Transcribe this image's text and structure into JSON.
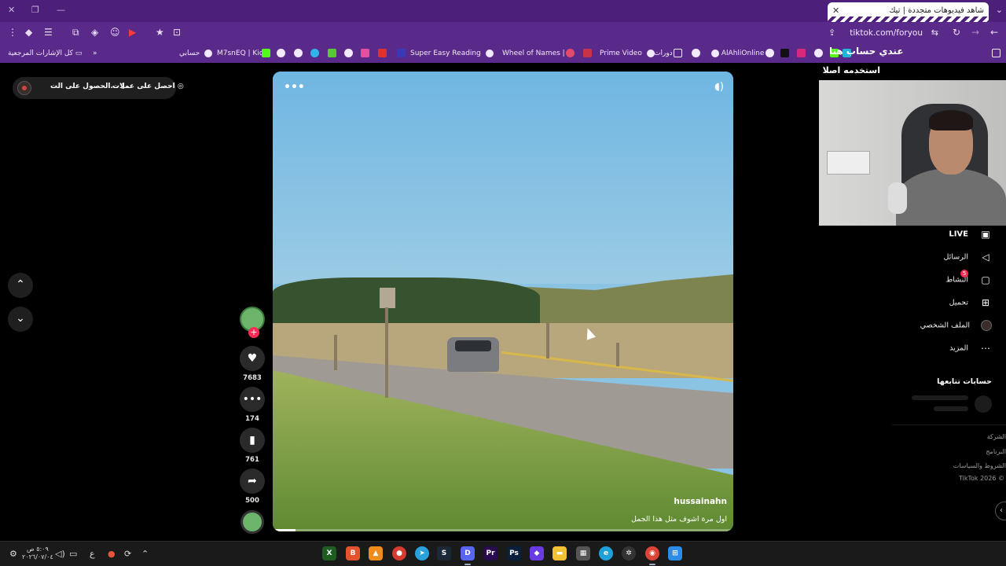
{
  "browser": {
    "tab_title": "شاهد فيديوهات متجددة | تيك",
    "url": "tiktok.com/foryou",
    "bookmarks": [
      "كل الإشارات المرجعية",
      "حسابي",
      "M7snEQ | Kick",
      "Super Easy Reading",
      "Wheel of Names | ...",
      "Prime Video",
      "دورات",
      "AlAhliOnline"
    ]
  },
  "left_header": {
    "coins_label": "احصل على عملات",
    "app_label": "الحصول على الت..."
  },
  "video": {
    "author": "hussainahn",
    "caption": "اول مرة اشوف مثل هذا الجمل",
    "progress": 0.05
  },
  "actions": {
    "likes": "7683",
    "comments": "174",
    "saves": "761",
    "shares": "500"
  },
  "overlay": {
    "title_text": "عندي حساب هنا",
    "subtitle": "استخدمه اصلا"
  },
  "sidebar": {
    "live": "LIVE",
    "messages": "الرسائل",
    "activity": "النشاط",
    "activity_badge": "5",
    "upload": "تحميل",
    "profile": "الملف الشخصي",
    "more": "المزيد",
    "following_title": "حسابات تتابعها",
    "footer": [
      "الشركة",
      "البرنامج",
      "الشروط والسياسات"
    ],
    "copyright": "TikTok 2026 ©"
  },
  "taskbar": {
    "time": "٥:٠٩ ص",
    "date": "٢٠٢٦/٠٧/٠٤",
    "lang": "ع"
  },
  "colors": {
    "browser_chrome": "#5a2a8a",
    "tiktok_red": "#fe2c55",
    "background": "#000000"
  }
}
